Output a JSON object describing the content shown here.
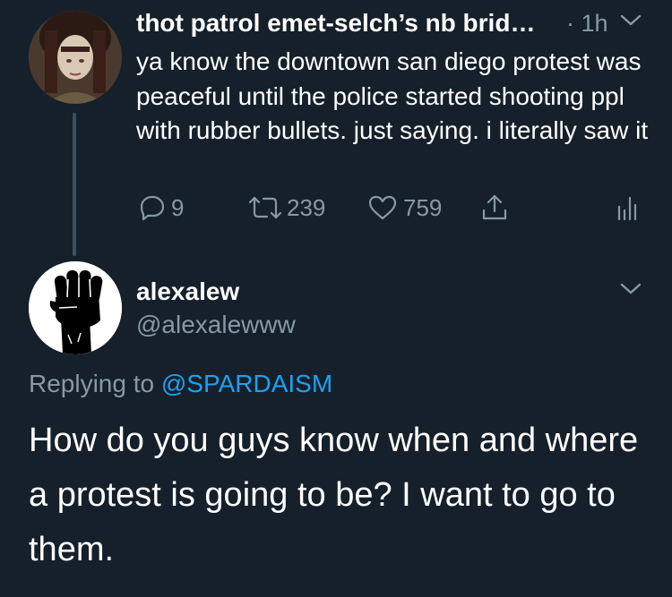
{
  "parent_tweet": {
    "display_name": "thot patrol emet-selch’s nb brid…",
    "time": "· 1h",
    "text": "ya know the downtown san diego protest was peaceful until the police started shooting ppl with rubber bullets. just saying. i literally saw it",
    "reply_count": "9",
    "retweet_count": "239",
    "like_count": "759",
    "icons": {
      "reply": "reply-icon",
      "retweet": "retweet-icon",
      "like": "heart-icon",
      "share": "share-icon",
      "analytics": "analytics-icon",
      "menu": "chevron-down-icon"
    }
  },
  "reply_tweet": {
    "display_name": "alexalew",
    "handle": "@alexalewww",
    "replying_prefix": "Replying to",
    "replying_to": "@SPARDAISM",
    "text": "How do you guys know when and where a protest is going to be? I want to go to them.",
    "avatar_icon": "raised-fist-icon"
  },
  "colors": {
    "background": "#15202b",
    "primary_text": "#ffffff",
    "secondary_text": "#8899a6",
    "accent": "#1da1f2",
    "thread_line": "#3d4f60"
  }
}
